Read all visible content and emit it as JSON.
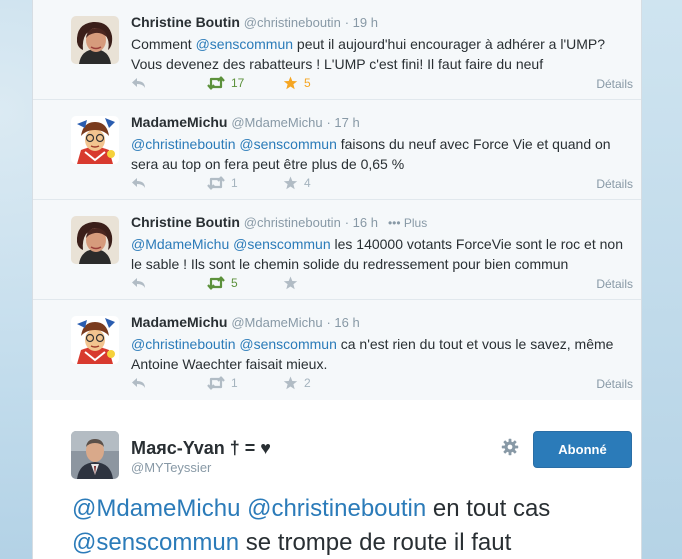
{
  "tweets": [
    {
      "name": "Christine Boutin",
      "handle": "@christineboutin",
      "time": "· 19 h",
      "more": "",
      "avatar": "cb",
      "line1": [
        {
          "t": "Comment ",
          "m": false
        },
        {
          "t": "@senscommun",
          "m": true
        },
        {
          "t": " peut il aujourd'hui encourager à adhérer a l'UMP?",
          "m": false
        }
      ],
      "line2": [
        {
          "t": "Vous devenez des rabatteurs ! L'UMP c'est fini! Il faut faire du neuf",
          "m": false
        }
      ],
      "retweets": "17",
      "favorites": "5",
      "retweeted": true,
      "favorited": true,
      "details": "Détails"
    },
    {
      "name": "MadameMichu",
      "handle": "@MdameMichu",
      "time": "· 17 h",
      "more": "",
      "avatar": "mm",
      "line1": [
        {
          "t": "@christineboutin",
          "m": true
        },
        {
          "t": " ",
          "m": false
        },
        {
          "t": "@senscommun",
          "m": true
        },
        {
          "t": " faisons du neuf avec Force Vie et quand on",
          "m": false
        }
      ],
      "line2": [
        {
          "t": "sera  au top on fera peut être plus de 0,65 %",
          "m": false
        }
      ],
      "retweets": "1",
      "favorites": "4",
      "retweeted": false,
      "favorited": false,
      "details": "Détails"
    },
    {
      "name": "Christine Boutin",
      "handle": "@christineboutin",
      "time": "· 16 h",
      "more": "••• Plus",
      "avatar": "cb",
      "line1": [
        {
          "t": "@MdameMichu",
          "m": true
        },
        {
          "t": " ",
          "m": false
        },
        {
          "t": "@senscommun",
          "m": true
        },
        {
          "t": " les 140000 votants ForceVie sont le roc et non",
          "m": false
        }
      ],
      "line2": [
        {
          "t": "le sable ! Ils sont le chemin solide du redressement pour bien commun",
          "m": false
        }
      ],
      "retweets": "5",
      "favorites": "",
      "retweeted": true,
      "favorited": false,
      "details": "Détails"
    },
    {
      "name": "MadameMichu",
      "handle": "@MdameMichu",
      "time": "· 16 h",
      "more": "",
      "avatar": "mm",
      "line1": [
        {
          "t": "@christineboutin",
          "m": true
        },
        {
          "t": " ",
          "m": false
        },
        {
          "t": "@senscommun",
          "m": true
        },
        {
          "t": " ca n'est rien du tout et vous le savez, même",
          "m": false
        }
      ],
      "line2": [
        {
          "t": "Antoine Waechter faisait mieux.",
          "m": false
        }
      ],
      "retweets": "1",
      "favorites": "2",
      "retweeted": false,
      "favorited": false,
      "details": "Détails"
    }
  ],
  "focused": {
    "name": "Маяс-Yvan † = ♥",
    "handle": "@MYTeyssier",
    "follow_label": "Abonné",
    "line1": [
      {
        "t": "@MdameMichu",
        "m": true
      },
      {
        "t": " ",
        "m": false
      },
      {
        "t": "@christineboutin",
        "m": true
      },
      {
        "t": " en tout cas",
        "m": false
      }
    ],
    "line2": [
      {
        "t": "@senscommun",
        "m": true
      },
      {
        "t": " se trompe de route il faut",
        "m": false
      }
    ]
  },
  "colors": {
    "mention": "#2b7bb9",
    "retweet_active": "#5c913b",
    "favorite_active": "#f5a623",
    "follow_button": "#2b7bb9"
  },
  "icons": [
    "reply-icon",
    "retweet-icon",
    "favorite-icon",
    "gear-icon"
  ]
}
